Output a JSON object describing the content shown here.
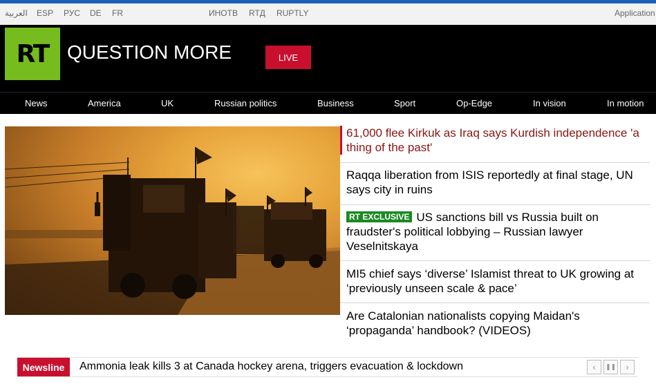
{
  "lang_bar": {
    "items": [
      "العربية",
      "ESP",
      "РУС",
      "DE",
      "FR",
      "ИНОТВ",
      "RTД",
      "RUPTLY"
    ],
    "applications": "Application"
  },
  "header": {
    "logo": "RT",
    "slogan": "QUESTION MORE",
    "live_label": "LIVE"
  },
  "nav": {
    "items": [
      "News",
      "America",
      "UK",
      "Russian politics",
      "Business",
      "Sport",
      "Op-Edge",
      "In vision",
      "In motion"
    ]
  },
  "hero": {
    "icon": "photo-convoy"
  },
  "headlines": [
    {
      "text": "61,000 flee Kirkuk as Iraq says Kurdish independence 'a thing of the past'"
    },
    {
      "text": "Raqqa liberation from ISIS reportedly at final stage, UN says city in ruins"
    },
    {
      "badge": "RT EXCLUSIVE",
      "text": "US sanctions bill vs Russia built on fraudster's political lobbying – Russian lawyer Veselnitskaya"
    },
    {
      "text": "MI5 chief says ‘diverse’ Islamist threat to UK growing at ‘previously unseen scale & pace’"
    },
    {
      "text": "Are Catalonian nationalists copying Maidan's ‘propaganda’ handbook? (VIDEOS)"
    }
  ],
  "newsline": {
    "label": "Newsline",
    "text": "Ammonia leak kills 3 at Canada hockey arena, triggers evacuation & lockdown",
    "controls": {
      "prev": "‹",
      "pause": "❚❚",
      "next": "›"
    }
  },
  "colors": {
    "accent": "#c8102e",
    "logo_green": "#77bc1f",
    "exclusive_green": "#1b8a24",
    "top_stripe": "#1f5fb8"
  }
}
